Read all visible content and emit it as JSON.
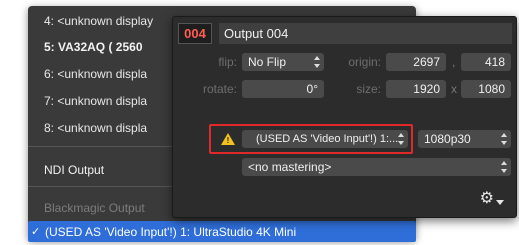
{
  "menu": {
    "items": [
      {
        "label": "4: <unknown display",
        "style": "normal"
      },
      {
        "label": "5: VA32AQ ( 2560",
        "style": "bold"
      },
      {
        "label": "6: <unknown displa",
        "style": "normal"
      },
      {
        "label": "7: <unknown displa",
        "style": "normal"
      },
      {
        "label": "8: <unknown displa",
        "style": "normal"
      }
    ],
    "ndi_label": "NDI Output",
    "blackmagic_label": "Blackmagic Output",
    "selected_check": "✓",
    "selected_label": "(USED AS 'Video Input'!) 1: UltraStudio 4K Mini"
  },
  "panel": {
    "number": "004",
    "name": "Output 004",
    "flip_label": "flip:",
    "flip_value": "No Flip",
    "origin_label": "origin:",
    "origin_x": "2697",
    "origin_sep": ",",
    "origin_y": "418",
    "rotate_label": "rotate:",
    "rotate_value": "0°",
    "size_label": "size:",
    "size_w": "1920",
    "size_sep": "x",
    "size_h": "1080",
    "device_value": "(USED AS 'Video Input'!) 1:...",
    "format_value": "1080p30",
    "mastering_value": "<no mastering>",
    "gear_glyph": "⚙",
    "warning_glyph": "!"
  },
  "colors": {
    "menu_bg": "#3a3a3a",
    "panel_bg": "#2c2c2c",
    "selection": "#2f6ed8",
    "number_red": "#ff5c52",
    "warning_outline": "#e02a2a",
    "warning_yellow": "#f2c21b"
  }
}
